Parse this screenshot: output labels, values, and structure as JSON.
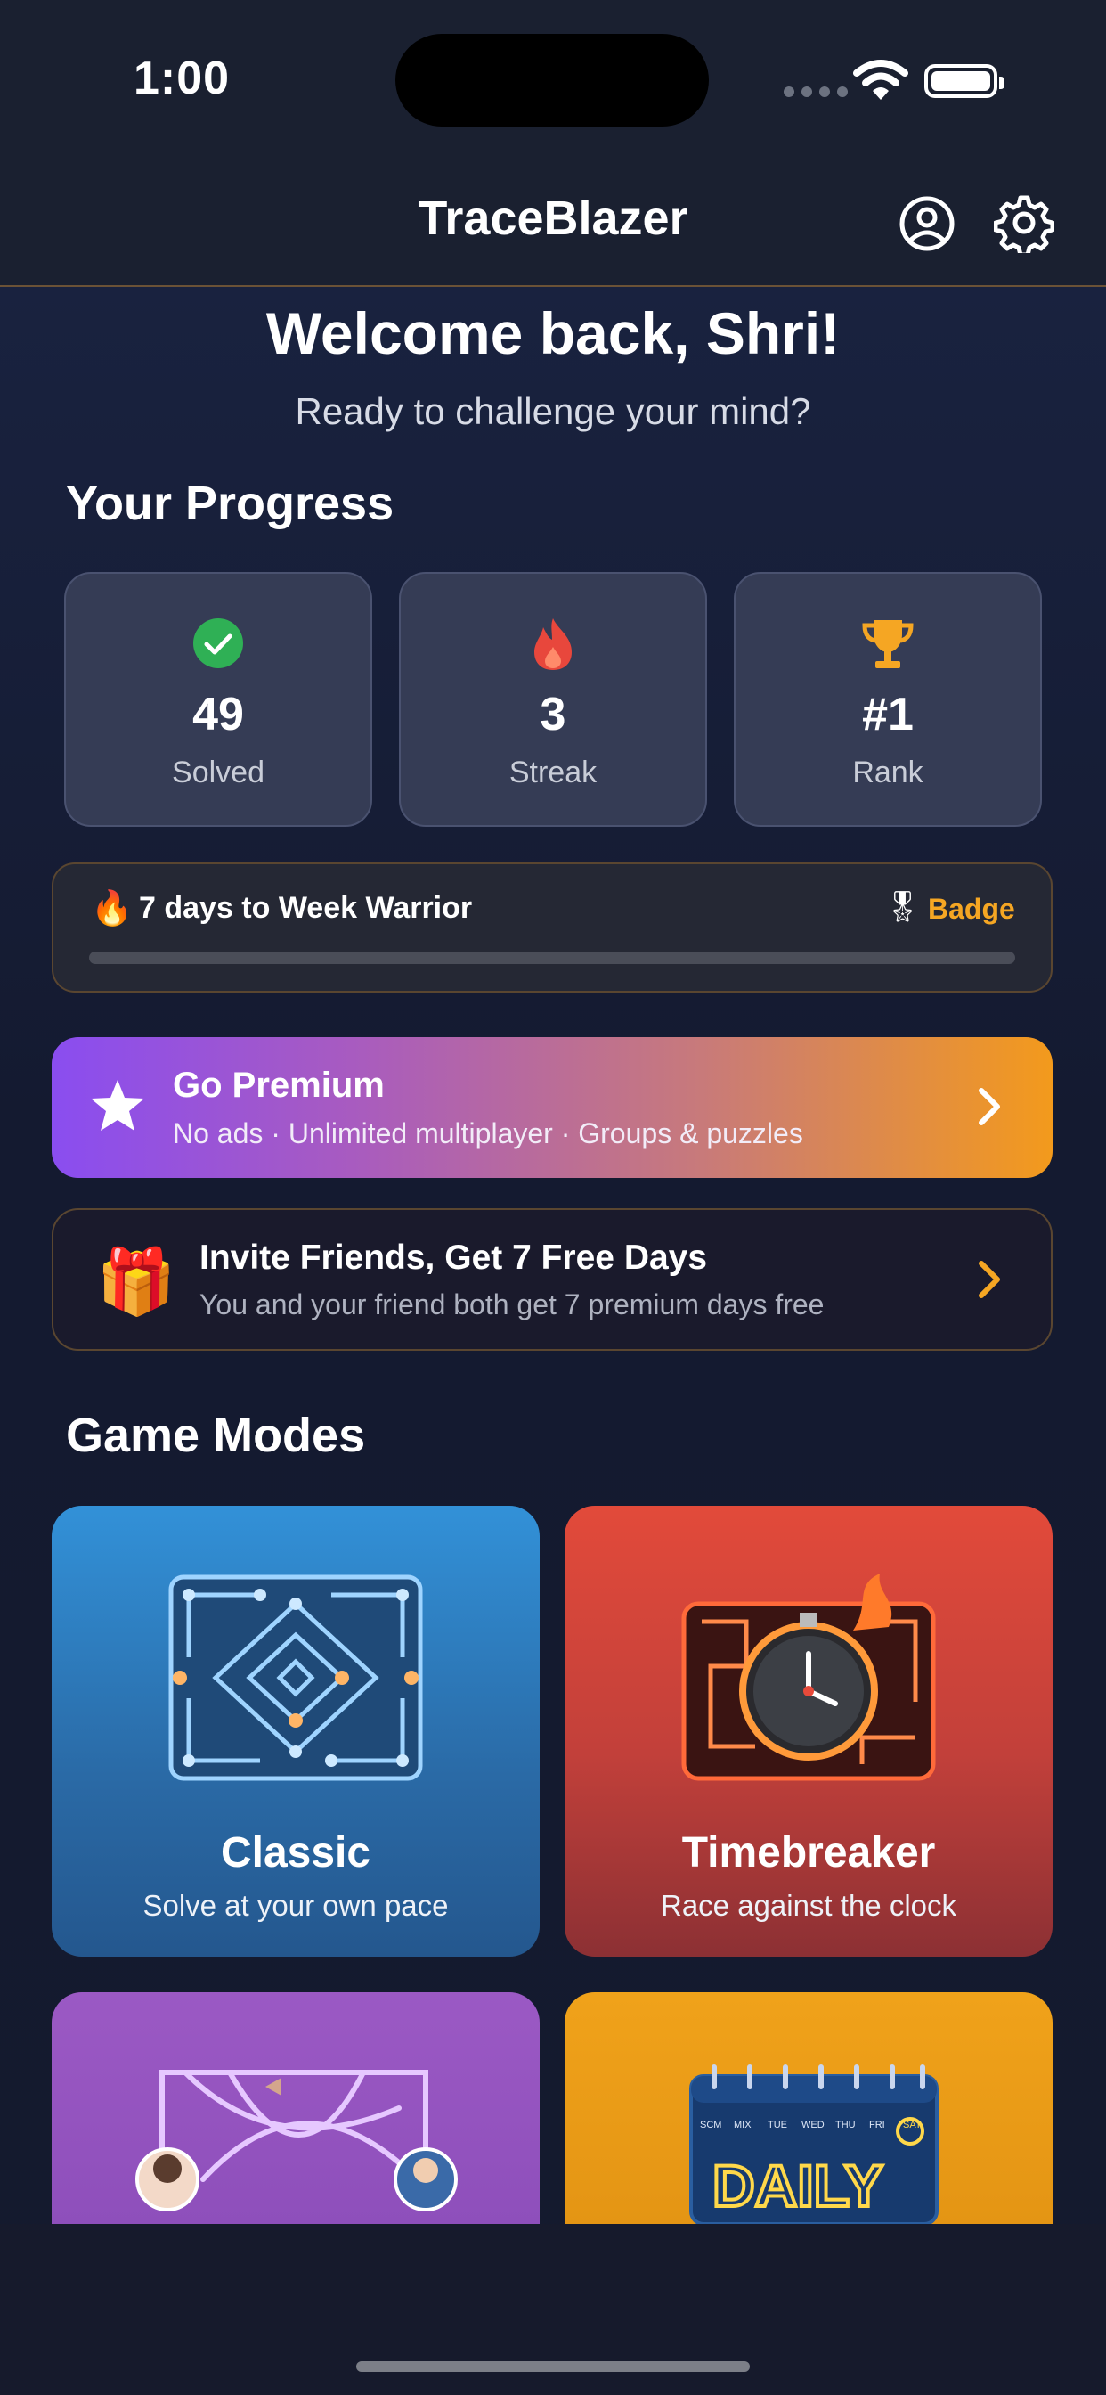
{
  "status_bar": {
    "time": "1:00"
  },
  "nav": {
    "title": "TraceBlazer",
    "profile_icon": "person-circle-icon",
    "settings_icon": "gear-icon"
  },
  "welcome": {
    "title": "Welcome back, Shri!",
    "subtitle": "Ready to challenge your mind?"
  },
  "progress": {
    "title": "Your Progress",
    "stats": [
      {
        "icon": "check-circle-icon",
        "value": "49",
        "label": "Solved",
        "color": "#2fb055"
      },
      {
        "icon": "flame-icon",
        "value": "3",
        "label": "Streak",
        "color": "#e8473c"
      },
      {
        "icon": "trophy-icon",
        "value": "#1",
        "label": "Rank",
        "color": "#f5a623"
      }
    ]
  },
  "goal": {
    "fire": "🔥",
    "text": "7 days to Week Warrior",
    "badge_icon": "🎖",
    "badge_label": "Badge",
    "progress_fraction": 0.0
  },
  "premium": {
    "title": "Go Premium",
    "subtitle": "No ads · Unlimited multiplayer · Groups & puzzles"
  },
  "invite": {
    "gift": "🎁",
    "title": "Invite Friends, Get 7 Free Days",
    "subtitle": "You and your friend both get 7 premium days free"
  },
  "game_modes": {
    "title": "Game Modes",
    "modes": [
      {
        "name": "Classic",
        "description": "Solve at your own pace"
      },
      {
        "name": "Timebreaker",
        "description": "Race against the clock"
      }
    ],
    "daily_art": {
      "days": [
        "SCM",
        "MIX",
        "TUE",
        "WED",
        "THU",
        "FRI",
        "SAT"
      ],
      "word": "DAILY"
    }
  },
  "colors": {
    "accent": "#f5a623",
    "background": "#141a30"
  }
}
